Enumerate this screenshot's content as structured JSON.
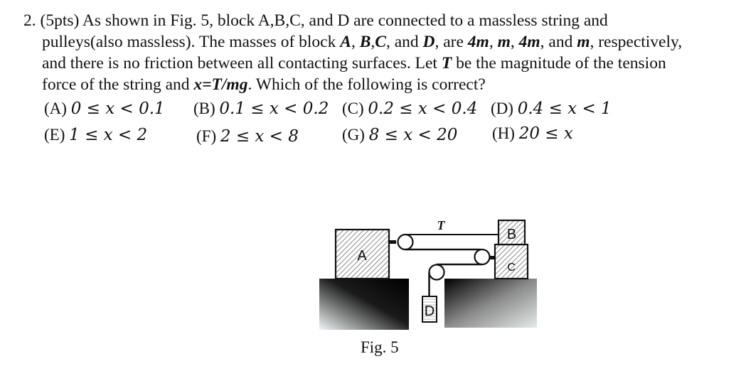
{
  "question": {
    "number": "2.",
    "points": "(5pts)",
    "line1": "As shown in Fig. 5, block A,B,C, and D are connected to a massless string and",
    "line2_pre": "pulleys(also massless). The masses of block ",
    "line2_A": "A",
    "line2_sep1": ", ",
    "line2_BC": "B",
    "line2_sep2": ",",
    "line2_C": "C",
    "line2_and": ", and ",
    "line2_D": "D",
    "line2_are": ", are ",
    "mass_A": "4m",
    "sep": ", ",
    "mass_B": "m",
    "mass_C": "4m",
    "and_text": ", and ",
    "mass_D": "m",
    "line2_post": ", respectively,",
    "line3_pre": "and there is no friction between all contacting surfaces. Let ",
    "line3_T": "T",
    "line3_post": " be the magnitude of the tension",
    "line4_pre": "force of the string and ",
    "line4_expr": "x=T/mg",
    "line4_post": ". Which of the following is correct?"
  },
  "options": [
    {
      "label": "(A)",
      "text": "0 ≤ x < 0.1"
    },
    {
      "label": "(B)",
      "text": "0.1 ≤ x < 0.2"
    },
    {
      "label": "(C)",
      "text": "0.2 ≤ x < 0.4"
    },
    {
      "label": "(D)",
      "text": "0.4 ≤ x < 1"
    },
    {
      "label": "(E)",
      "text": "1 ≤ x < 2"
    },
    {
      "label": "(F)",
      "text": "2 ≤ x < 8"
    },
    {
      "label": "(G)",
      "text": "8 ≤ x < 20"
    },
    {
      "label": "(H)",
      "text": "20 ≤ x"
    }
  ],
  "figure": {
    "caption": "Fig. 5",
    "tension_label": "T",
    "blocks": {
      "A": "A",
      "B": "B",
      "C": "C",
      "D": "D"
    }
  }
}
